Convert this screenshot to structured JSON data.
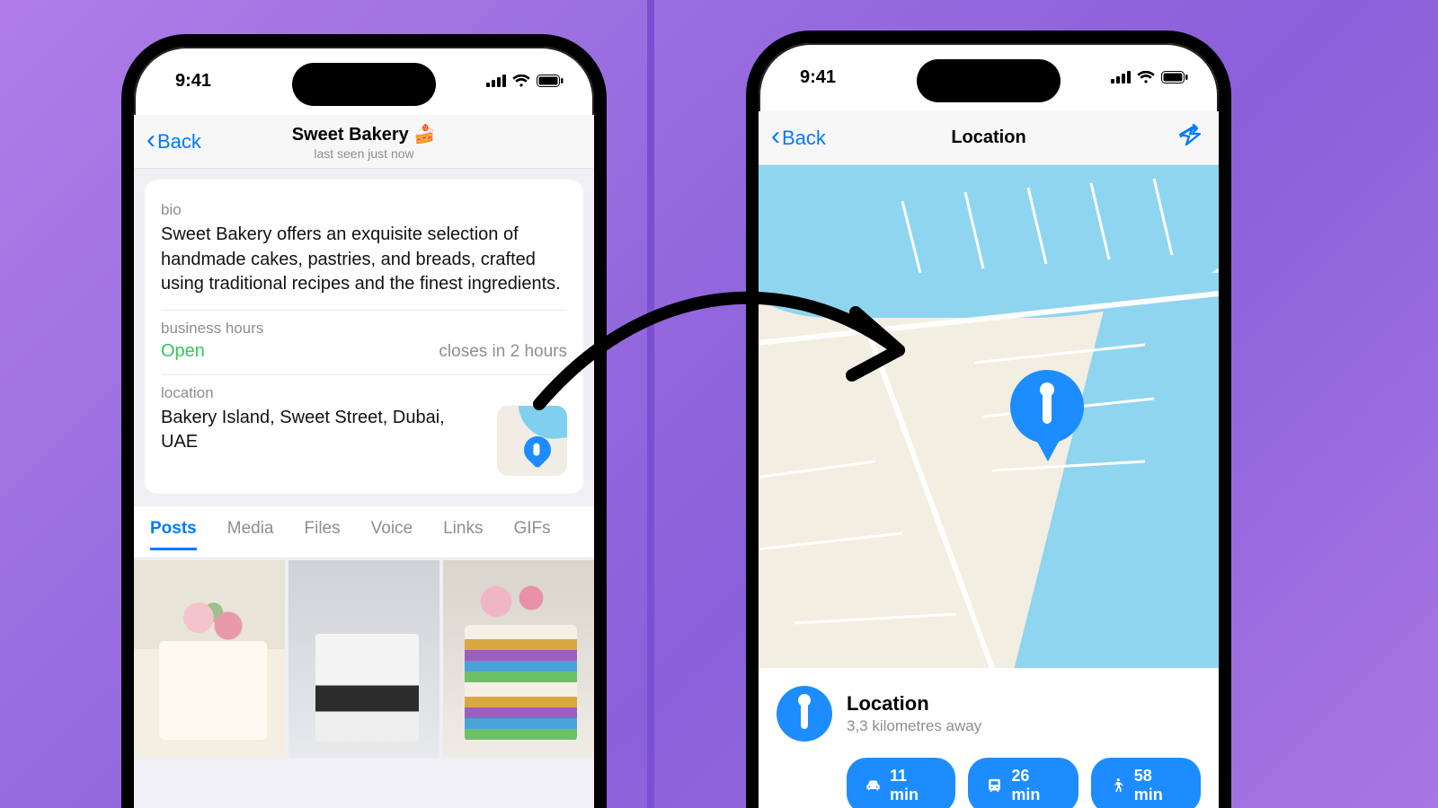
{
  "status": {
    "time": "9:41"
  },
  "left": {
    "back": "Back",
    "title": "Sweet Bakery 🍰",
    "subtitle": "last seen just now",
    "bio_label": "bio",
    "bio_text": "Sweet Bakery offers an exquisite selection of handmade cakes, pastries, and breads, crafted using traditional recipes and the finest ingredients.",
    "hours_label": "business hours",
    "hours_status": "Open",
    "hours_closes": "closes in 2 hours",
    "location_label": "location",
    "address": "Bakery Island, Sweet Street, Dubai, UAE",
    "tabs": [
      "Posts",
      "Media",
      "Files",
      "Voice",
      "Links",
      "GIFs"
    ]
  },
  "right": {
    "back": "Back",
    "title": "Location",
    "sheet_title": "Location",
    "distance": "3,3 kilometres away",
    "travel": [
      {
        "mode": "car",
        "time": "11 min"
      },
      {
        "mode": "transit",
        "time": "26 min"
      },
      {
        "mode": "walk",
        "time": "58 min"
      }
    ]
  }
}
